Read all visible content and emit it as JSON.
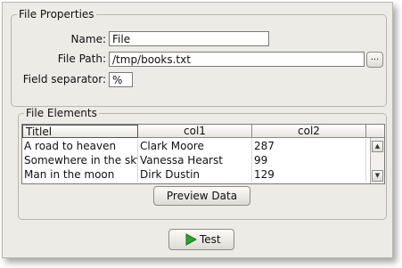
{
  "file_properties": {
    "title": "File Properties",
    "name_label": "Name:",
    "name_value": "File",
    "path_label": "File Path:",
    "path_value": "/tmp/books.txt",
    "browse_label": "...",
    "separator_label": "Field separator:",
    "separator_value": "%"
  },
  "file_elements": {
    "title": "File Elements",
    "columns": [
      "Titlel",
      "col1",
      "col2"
    ],
    "rows": [
      [
        "A road to heaven",
        "Clark Moore",
        "287"
      ],
      [
        "Somewhere in the sky",
        "Vanessa Hearst",
        "99"
      ],
      [
        "Man in the moon",
        "Dirk Dustin",
        "129"
      ]
    ],
    "preview_button": "Preview Data"
  },
  "test_button": {
    "label": "Test",
    "icon": "play-icon",
    "icon_color": "#2aa52a"
  }
}
